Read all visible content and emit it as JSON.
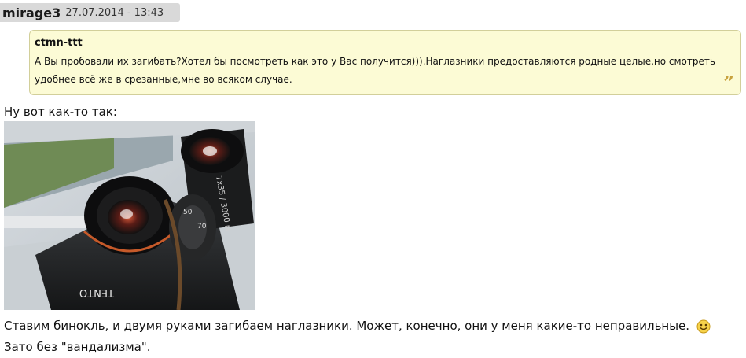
{
  "post": {
    "author": "mirage3",
    "date": "27.07.2014 - 13:43"
  },
  "quote": {
    "author": "ctmn-ttt",
    "text": "А Вы пробовали их загибать?Хотел бы посмотреть как это у Вас получится))).Наглазники предоставляются родные целые,но смотреть удобнее всё же в срезанные,мне во всяком случае.",
    "mark": "”"
  },
  "message": {
    "intro": "Ну вот как-то так:",
    "line1": "Ставим бинокль, и двумя руками загибаем наглазники. Может, конечно, они у меня какие-то неправильные.",
    "line2": "Зато без \"вандализма\"."
  },
  "photo": {
    "label_brand": "TENTO",
    "label_spec": "7x35 / 3000 м",
    "dial_numbers": [
      "50",
      "70"
    ]
  },
  "colors": {
    "header_bg": "#d9d9d9",
    "quote_bg": "#fcfbd5",
    "quote_border": "#d2cf9a",
    "quote_mark": "#c8a23e"
  },
  "icons": [
    "quote-icon",
    "smiley-icon"
  ]
}
